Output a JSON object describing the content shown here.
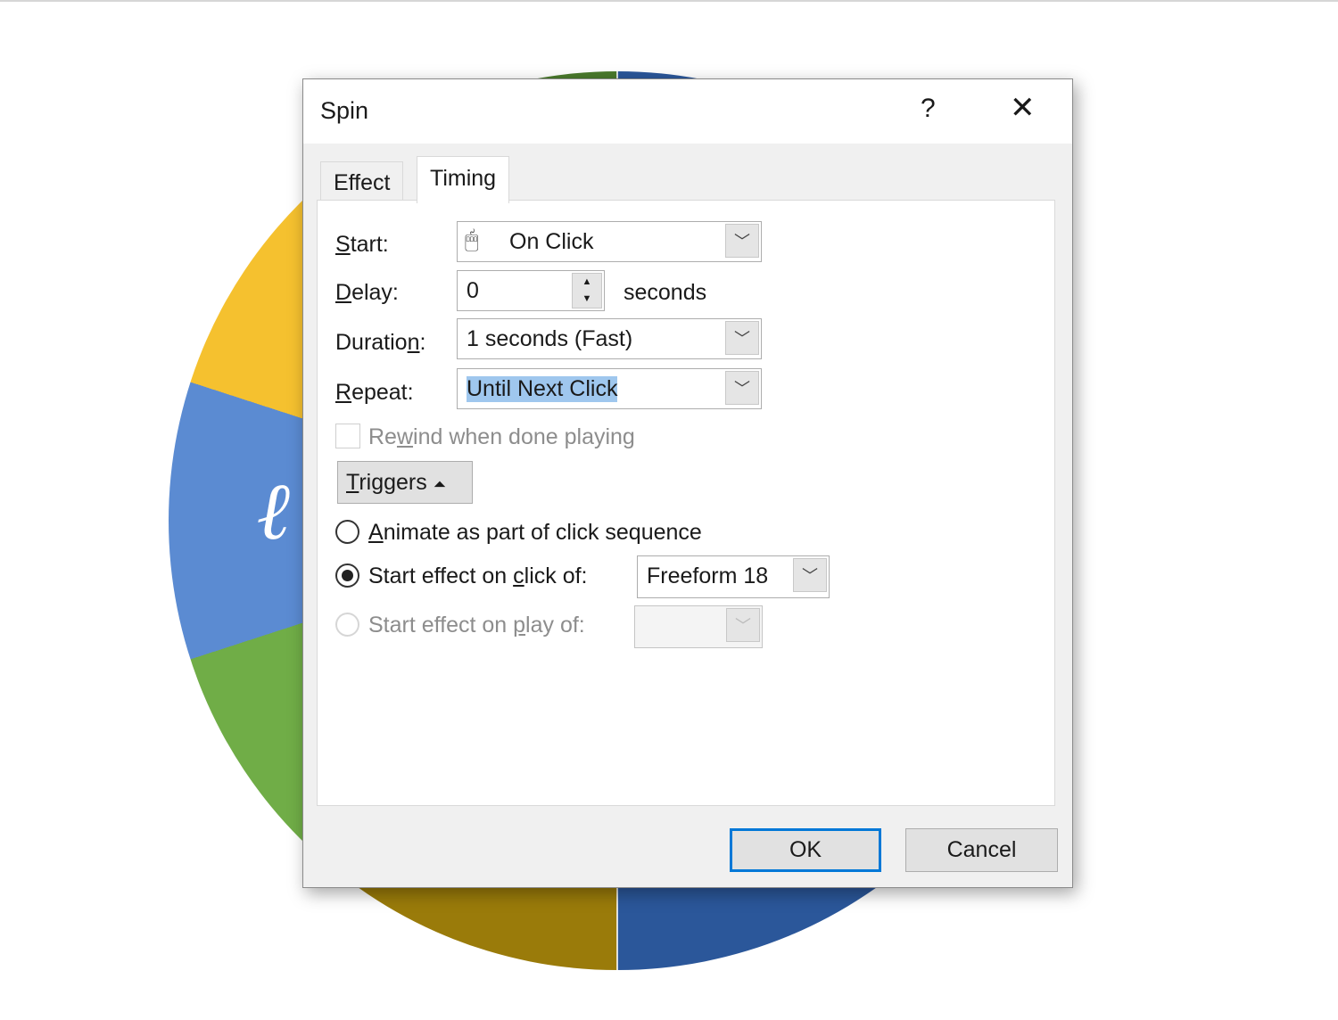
{
  "background": {
    "wheel_colors": [
      "#2b579a",
      "#9a7b0a",
      "#70ad47",
      "#5b8bd2",
      "#f5c12f",
      "#4a7a2c"
    ]
  },
  "dialog": {
    "title": "Spin",
    "help_label": "?",
    "close_icon": "close-icon",
    "tabs": [
      {
        "label": "Effect",
        "active": false
      },
      {
        "label": "Timing",
        "active": true
      }
    ],
    "start": {
      "label_key": "S",
      "label_rest": "tart:",
      "value": "On Click",
      "icon": "mouse-click-icon"
    },
    "delay": {
      "label_key": "D",
      "label_rest": "elay:",
      "value": "0",
      "unit": "seconds"
    },
    "duration": {
      "label_pre": "Duratio",
      "label_key": "n",
      "label_rest": ":",
      "value": "1 seconds (Fast)"
    },
    "repeat": {
      "label_key": "R",
      "label_rest": "epeat:",
      "value": "Until Next Click"
    },
    "rewind": {
      "label_pre": "Re",
      "label_key": "w",
      "label_rest": "ind when done playing",
      "checked": false,
      "disabled": true
    },
    "triggers": {
      "label_key": "T",
      "label_rest": "riggers",
      "icon": "double-chevron-up-icon"
    },
    "radio_sequence": {
      "label_key": "A",
      "label_rest": "nimate as part of click sequence",
      "selected": false
    },
    "radio_click": {
      "label_pre": "Start effect on ",
      "label_key": "c",
      "label_rest": "lick of:",
      "selected": true,
      "value": "Freeform 18"
    },
    "radio_play": {
      "label_pre": "Start effect on ",
      "label_key": "p",
      "label_rest": "lay of:",
      "selected": false,
      "disabled": true,
      "value": ""
    },
    "ok_label": "OK",
    "cancel_label": "Cancel",
    "accent": "#0078d7",
    "selection_color": "#9fc7ee"
  }
}
